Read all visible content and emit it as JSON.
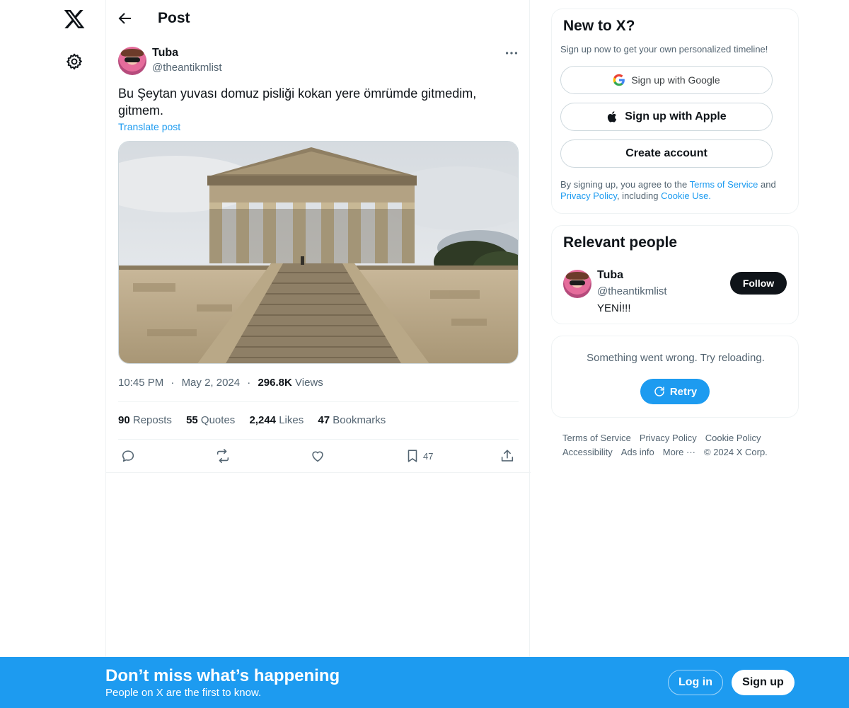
{
  "nav": {
    "logo_icon": "x-logo-icon",
    "settings_icon": "gear-icon"
  },
  "header": {
    "title": "Post",
    "back_icon": "arrow-left-icon"
  },
  "post": {
    "author_name": "Tuba",
    "author_handle": "@theantikmlist",
    "text": "Bu Şeytan yuvası domuz pisliği kokan yere ömrümde gitmedim, gitmem.",
    "translate_label": "Translate post",
    "media_icon": "photo-temple-image",
    "time": "10:45 PM",
    "dot": "·",
    "date": "May 2, 2024",
    "views_count": "296.8K",
    "views_label": "Views",
    "stats": {
      "reposts_count": "90",
      "reposts_label": "Reposts",
      "quotes_count": "55",
      "quotes_label": "Quotes",
      "likes_count": "2,244",
      "likes_label": "Likes",
      "bookmarks_count": "47",
      "bookmarks_label": "Bookmarks"
    },
    "actions": {
      "bookmark_count": "47"
    }
  },
  "signup_card": {
    "title": "New to X?",
    "subtitle": "Sign up now to get your own personalized timeline!",
    "google_label": "Sign up with Google",
    "apple_label": "Sign up with Apple",
    "create_label": "Create account",
    "legal_prefix": "By signing up, you agree to the ",
    "terms_link": "Terms of Service",
    "legal_and": " and ",
    "privacy_link": "Privacy Policy",
    "legal_including": ", including ",
    "cookie_link": "Cookie Use."
  },
  "people_card": {
    "title": "Relevant people",
    "name": "Tuba",
    "handle": "@theantikmlist",
    "bio": "YENİ!!!",
    "follow_label": "Follow"
  },
  "error_card": {
    "message": "Something went wrong. Try reloading.",
    "retry_label": "Retry"
  },
  "footer": {
    "terms": "Terms of Service",
    "privacy": "Privacy Policy",
    "cookie": "Cookie Policy",
    "accessibility": "Accessibility",
    "ads": "Ads info",
    "more": "More ···",
    "copyright": "© 2024 X Corp."
  },
  "banner": {
    "title": "Don’t miss what’s happening",
    "subtitle": "People on X are the first to know.",
    "login_label": "Log in",
    "signup_label": "Sign up"
  },
  "colors": {
    "accent": "#1d9bf0",
    "text": "#0f1419",
    "muted": "#536471"
  }
}
